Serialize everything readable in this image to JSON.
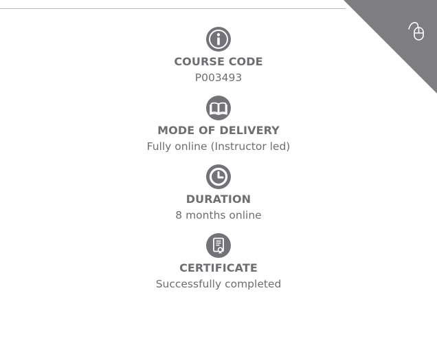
{
  "colors": {
    "text": "#6e6e72",
    "icon": "#727278",
    "ribbon": "#7d7d82",
    "rule": "#b9b9bd"
  },
  "corner": {
    "icon": "mouse-pointer-icon"
  },
  "items": [
    {
      "icon": "info-icon",
      "title": "COURSE CODE",
      "value": "P003493"
    },
    {
      "icon": "book-icon",
      "title": "MODE OF DELIVERY",
      "value": "Fully online (Instructor led)"
    },
    {
      "icon": "clock-icon",
      "title": "DURATION",
      "value": "8 months online"
    },
    {
      "icon": "certificate-icon",
      "title": "CERTIFICATE",
      "value": "Successfully completed"
    }
  ]
}
